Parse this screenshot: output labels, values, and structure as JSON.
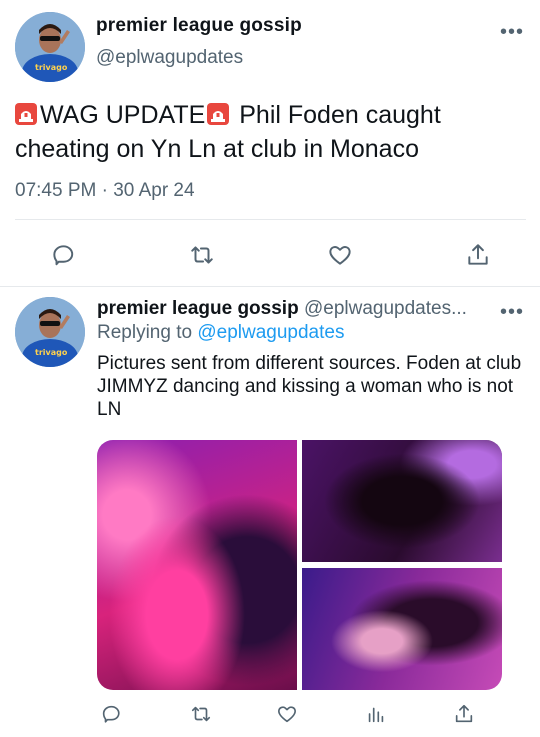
{
  "tweet": {
    "author_name": "premier league gossip",
    "author_handle": "@eplwagupdates",
    "text": "WAG UPDATE Phil Foden caught cheating on Yn Ln at club in Monaco",
    "text_prefix": "WAG UPDATE",
    "text_rest": "Phil Foden caught cheating on Yn Ln at club in Monaco",
    "timestamp": "07:45 PM · 30 Apr 24"
  },
  "reply": {
    "author_name": "premier league gossip",
    "author_handle_truncated": "@eplwagupdates...",
    "replying_to_label": "Replying to",
    "replying_to_handle": "@eplwagupdates",
    "text": "Pictures sent from different sources. Foden at club JIMMYZ dancing and kissing a woman who is not LN"
  },
  "icons": {
    "siren": "police-car-light-icon",
    "more": "more-horizontal-icon",
    "reply": "reply-icon",
    "retweet": "retweet-icon",
    "like": "heart-icon",
    "share": "share-icon",
    "views": "views-chart-icon"
  },
  "colors": {
    "link": "#1d9bf0",
    "secondary_text": "#536471",
    "divider": "#e6e9ec"
  }
}
